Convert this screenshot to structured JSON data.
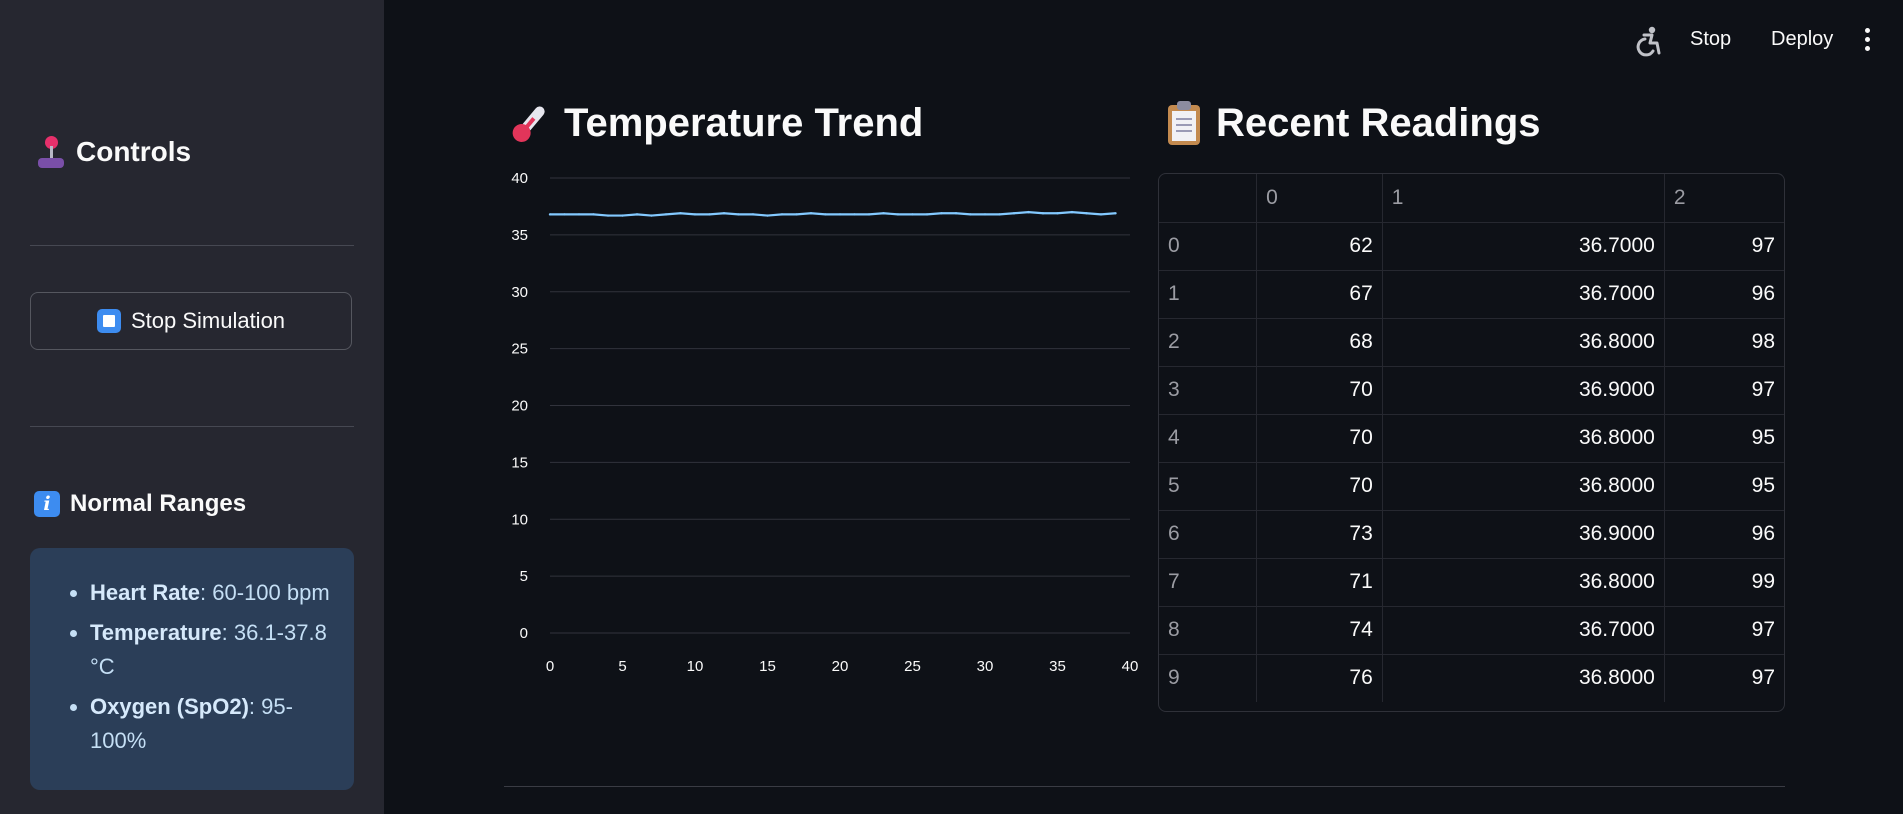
{
  "sidebar": {
    "title": "Controls",
    "stop_button_label": "Stop Simulation",
    "normal_ranges_title": "Normal Ranges",
    "ranges": [
      {
        "label": "Heart Rate",
        "value": ": 60-100 bpm"
      },
      {
        "label": "Temperature",
        "value": ": 36.1-37.8 °C"
      },
      {
        "label": "Oxygen (SpO2)",
        "value": ": 95-100%"
      }
    ]
  },
  "topbar": {
    "stop_label": "Stop",
    "deploy_label": "Deploy"
  },
  "main": {
    "chart_title": "Temperature Trend",
    "table_title": "Recent Readings",
    "table": {
      "columns": [
        "",
        "0",
        "1",
        "2"
      ],
      "rows": [
        [
          "0",
          "62",
          "36.7000",
          "97"
        ],
        [
          "1",
          "67",
          "36.7000",
          "96"
        ],
        [
          "2",
          "68",
          "36.8000",
          "98"
        ],
        [
          "3",
          "70",
          "36.9000",
          "97"
        ],
        [
          "4",
          "70",
          "36.8000",
          "95"
        ],
        [
          "5",
          "70",
          "36.8000",
          "95"
        ],
        [
          "6",
          "73",
          "36.9000",
          "96"
        ],
        [
          "7",
          "71",
          "36.8000",
          "99"
        ],
        [
          "8",
          "74",
          "36.7000",
          "97"
        ],
        [
          "9",
          "76",
          "36.8000",
          "97"
        ]
      ]
    }
  },
  "colors": {
    "line": "#83c9ff",
    "accent": "#3d8cf0",
    "info_box": "#2b3e58"
  },
  "chart_data": {
    "type": "line",
    "title": "",
    "xlabel": "",
    "ylabel": "",
    "xlim": [
      0,
      40
    ],
    "ylim": [
      0,
      40
    ],
    "x_ticks": [
      0,
      5,
      10,
      15,
      20,
      25,
      30,
      35,
      40
    ],
    "y_ticks": [
      0,
      5,
      10,
      15,
      20,
      25,
      30,
      35,
      40
    ],
    "grid": true,
    "series": [
      {
        "x": [
          0,
          1,
          2,
          3,
          4,
          5,
          6,
          7,
          8,
          9,
          10,
          11,
          12,
          13,
          14,
          15,
          16,
          17,
          18,
          19,
          20,
          21,
          22,
          23,
          24,
          25,
          26,
          27,
          28,
          29,
          30,
          31,
          32,
          33,
          34,
          35,
          36,
          37,
          38,
          39
        ],
        "values": [
          36.8,
          36.8,
          36.8,
          36.8,
          36.7,
          36.7,
          36.8,
          36.7,
          36.8,
          36.9,
          36.8,
          36.8,
          36.9,
          36.8,
          36.8,
          36.7,
          36.8,
          36.8,
          36.9,
          36.8,
          36.8,
          36.8,
          36.8,
          36.9,
          36.8,
          36.8,
          36.8,
          36.9,
          36.9,
          36.8,
          36.8,
          36.8,
          36.9,
          37.0,
          36.9,
          36.9,
          37.0,
          36.9,
          36.8,
          36.9
        ]
      }
    ]
  }
}
